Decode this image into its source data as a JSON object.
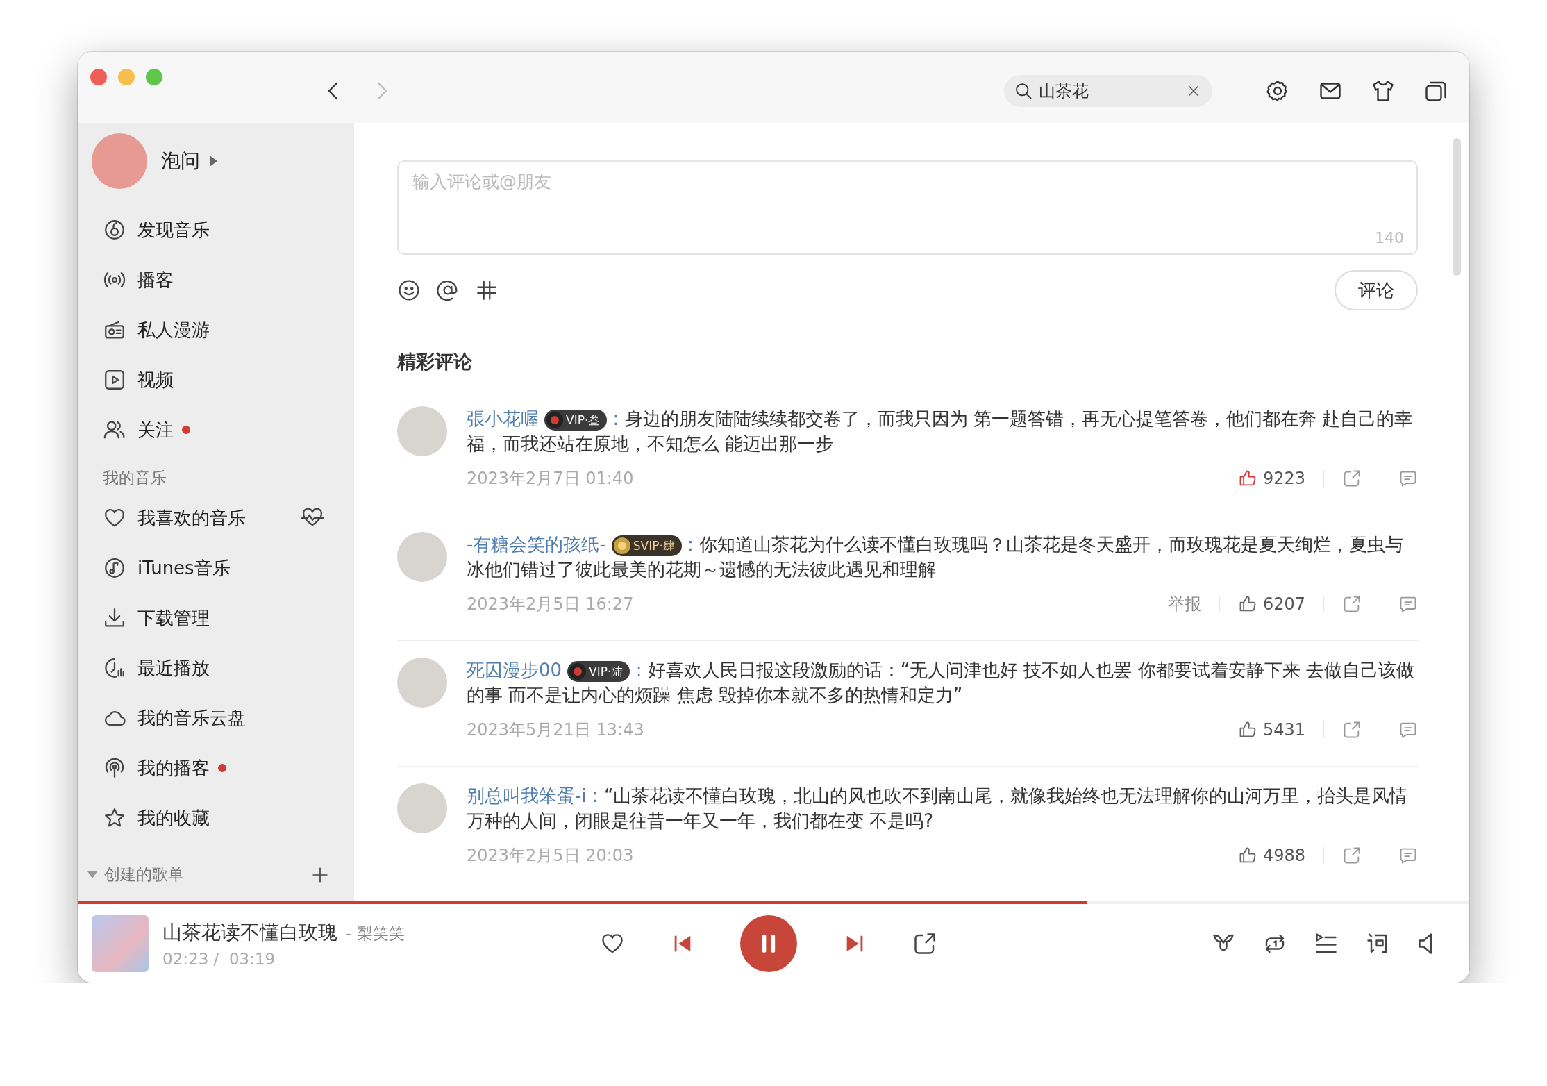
{
  "window": {
    "nav": {
      "back_disabled": false,
      "forward_disabled": true
    }
  },
  "search": {
    "value": "山茶花"
  },
  "toolbar": [
    {
      "kind": "settings"
    },
    {
      "kind": "mail"
    },
    {
      "kind": "shirt"
    },
    {
      "kind": "miniwindow"
    }
  ],
  "user": {
    "name": "泡问"
  },
  "sidebar": {
    "items": [
      {
        "kind": "discover",
        "label": "发现音乐",
        "unread": false
      },
      {
        "kind": "podcast",
        "label": "播客",
        "unread": false
      },
      {
        "kind": "radio",
        "label": "私人漫游",
        "unread": false
      },
      {
        "kind": "video",
        "label": "视频",
        "unread": false
      },
      {
        "kind": "follow",
        "label": "关注",
        "unread": true
      }
    ],
    "section_title": "我的音乐",
    "my_music": [
      {
        "kind": "heart",
        "label": "我喜欢的音乐",
        "unread": false,
        "heartbeat_button": true
      },
      {
        "kind": "note",
        "label": "iTunes音乐",
        "unread": false
      },
      {
        "kind": "download",
        "label": "下载管理",
        "unread": false
      },
      {
        "kind": "recent",
        "label": "最近播放",
        "unread": false
      },
      {
        "kind": "cloud",
        "label": "我的音乐云盘",
        "unread": false
      },
      {
        "kind": "mypodcast",
        "label": "我的播客",
        "unread": true
      },
      {
        "kind": "star",
        "label": "我的收藏",
        "unread": false
      }
    ],
    "playlists": {
      "title": "创建的歌单",
      "expanded": true
    }
  },
  "comment_box": {
    "placeholder": "输入评论或@朋友",
    "counter": "140",
    "tools": [
      {
        "kind": "emoji"
      },
      {
        "kind": "at"
      },
      {
        "kind": "hash"
      }
    ],
    "submit": "评论"
  },
  "comments_title": "精彩评论",
  "comments": [
    {
      "user": "張小花喔",
      "colon": ":",
      "badge": {
        "kind": "vip",
        "label": "VIP·叁"
      },
      "text": "身边的朋友陆陆续续都交卷了，而我只因为 第一题答错，再无心提笔答卷，他们都在奔 赴自己的幸福，而我还站在原地，不知怎么 能迈出那一步",
      "time": "2023年2月7日 01:40",
      "likes": "9223",
      "liked": true
    },
    {
      "user": "-有糖会笑的孩纸-",
      "colon": ":",
      "badge": {
        "kind": "svip",
        "label": "SVIP·肆"
      },
      "text": "你知道山茶花为什么读不懂白玫瑰吗？山茶花是冬天盛开，而玫瑰花是夏天绚烂，夏虫与冰他们错过了彼此最美的花期～遗憾的无法彼此遇见和理解",
      "time": "2023年2月5日 16:27",
      "report": "举报",
      "likes": "6207",
      "liked": false
    },
    {
      "user": "死囚漫步00",
      "colon": ":",
      "badge": {
        "kind": "vip",
        "label": "VIP·陆"
      },
      "text": "好喜欢人民日报这段激励的话：“无人问津也好 技不如人也罢 你都要试着安静下来 去做自己该做的事 而不是让内心的烦躁 焦虑 毁掉你本就不多的热情和定力”",
      "time": "2023年5月21日 13:43",
      "likes": "5431",
      "liked": false
    },
    {
      "user": "别总叫我笨蛋-i",
      "colon": ":",
      "text": "“山茶花读不懂白玫瑰，北山的风也吹不到南山尾，就像我始终也无法理解你的山河万里，抬头是风情万种的人间，闭眼是往昔一年又一年，我们都在变 不是吗?",
      "time": "2023年2月5日 20:03",
      "likes": "4988",
      "liked": false
    }
  ],
  "player": {
    "title": "山茶花读不懂白玫瑰",
    "artist": "- 梨笑笑",
    "time": "02:23 /  03:19",
    "progress": {
      "level": 0.725
    },
    "liked": false,
    "playing": true,
    "right_tools": [
      {
        "kind": "effects"
      },
      {
        "kind": "repeat-one"
      },
      {
        "kind": "playlist"
      },
      {
        "kind": "lyrics"
      },
      {
        "kind": "volume"
      }
    ]
  }
}
